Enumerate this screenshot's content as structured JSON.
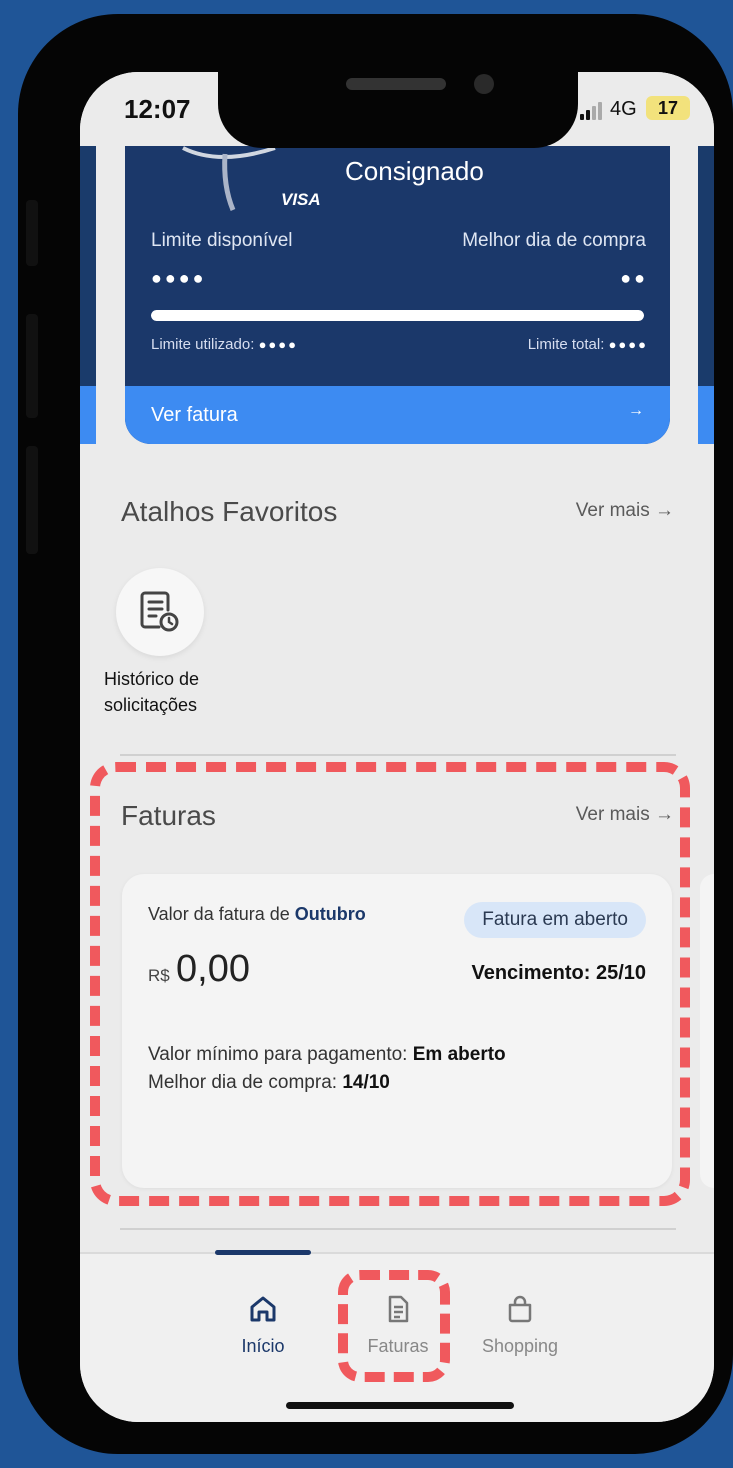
{
  "status_bar": {
    "time": "12:07",
    "network": "4G",
    "battery": "17",
    "signal_bars_active": 2
  },
  "card": {
    "product": "Consignado",
    "brand": "VISA",
    "available_limit_label": "Limite disponível",
    "available_limit_value": "●●●●",
    "best_day_label": "Melhor dia de compra",
    "best_day_value": "●●",
    "limit_used_fraction": 1.0,
    "used_label": "Limite utilizado:",
    "used_value": "●●●●",
    "total_label": "Limite total:",
    "total_value": "●●●●",
    "cta_label": "Ver fatura",
    "cta_arrow": "→"
  },
  "shortcuts": {
    "title": "Atalhos Favoritos",
    "more_label": "Ver mais →",
    "items": [
      {
        "label": "Histórico de solicitações",
        "icon": "request-history-icon"
      }
    ]
  },
  "invoices": {
    "title": "Faturas",
    "more_label": "Ver mais →",
    "card": {
      "month_prefix": "Valor da fatura de",
      "month": "Outubro",
      "status": "Fatura em aberto",
      "currency": "R$",
      "amount": "0,00",
      "due": "Vencimento: 25/10",
      "min_payment_label": "Valor mínimo para pagamento:",
      "min_payment_value": "Em aberto",
      "best_day_label": "Melhor dia de compra:",
      "best_day_value": "14/10"
    }
  },
  "bottom_nav": {
    "items": [
      {
        "label": "Início",
        "icon": "home-icon",
        "active": true
      },
      {
        "label": "Faturas",
        "icon": "invoice-icon",
        "active": false
      },
      {
        "label": "Shopping",
        "icon": "shopping-bag-icon",
        "active": false
      }
    ]
  },
  "colors": {
    "background": "#1f5597",
    "card_navy": "#1b386a",
    "accent_blue": "#3d8bf2",
    "highlight_red": "#f0595d",
    "status_pill": "#d8e6f8"
  }
}
